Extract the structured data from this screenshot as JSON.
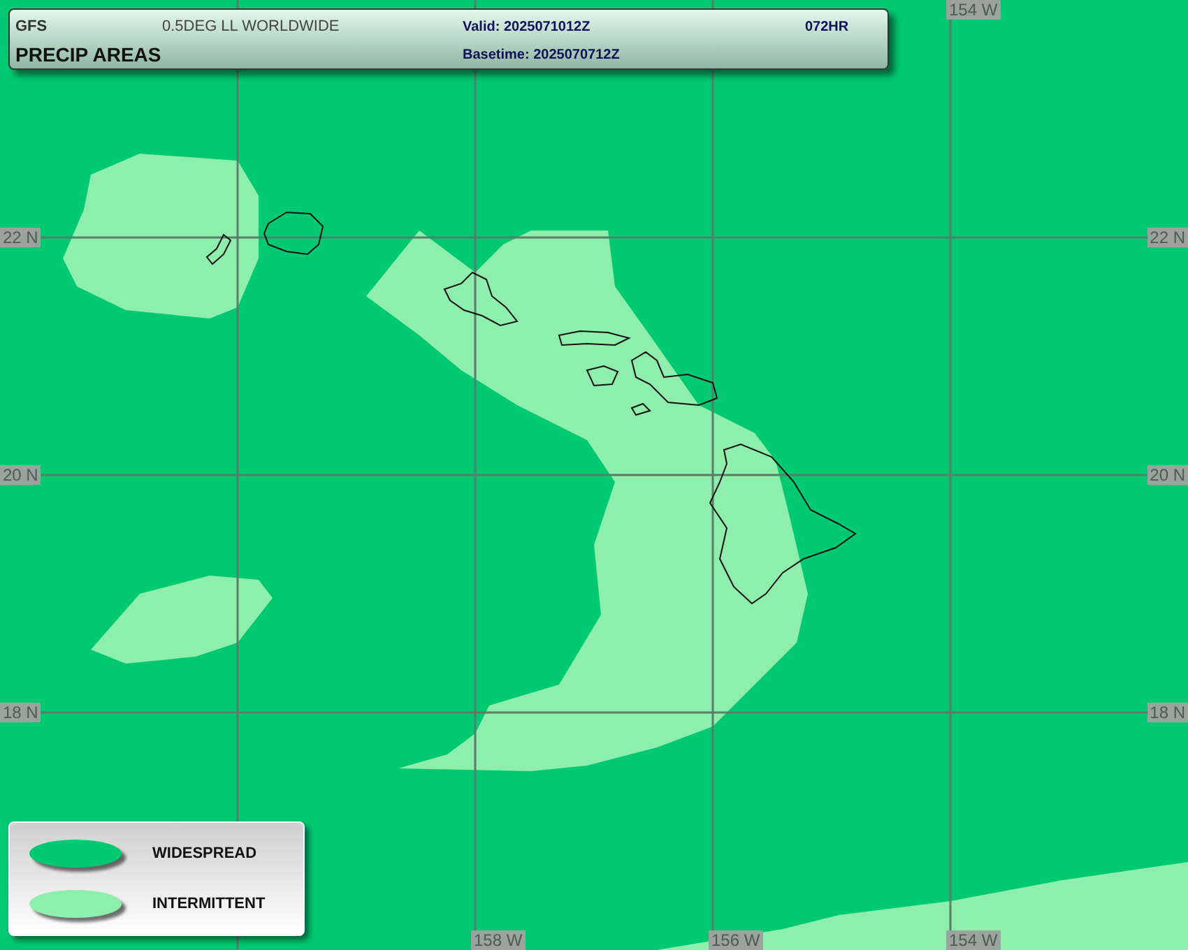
{
  "header": {
    "model": "GFS",
    "grid": "0.5DEG LL WORLDWIDE",
    "title": "PRECIP AREAS",
    "valid": "Valid: 2025071012Z",
    "basetime": "Basetime: 2025070712Z",
    "forecast_hour": "072HR"
  },
  "map": {
    "latitude_labels": [
      {
        "left": "22 N",
        "right": "22 N"
      },
      {
        "left": "20 N",
        "right": "20 N"
      },
      {
        "left": "18 N",
        "right": "18 N"
      }
    ],
    "top_longitude_labels": [
      "154 W"
    ],
    "bottom_longitude_labels": [
      "158 W",
      "156 W",
      "154 W"
    ]
  },
  "legend": [
    {
      "label": "WIDESPREAD",
      "color": "#00c972"
    },
    {
      "label": "INTERMITTENT",
      "color": "#8eeeab"
    }
  ]
}
